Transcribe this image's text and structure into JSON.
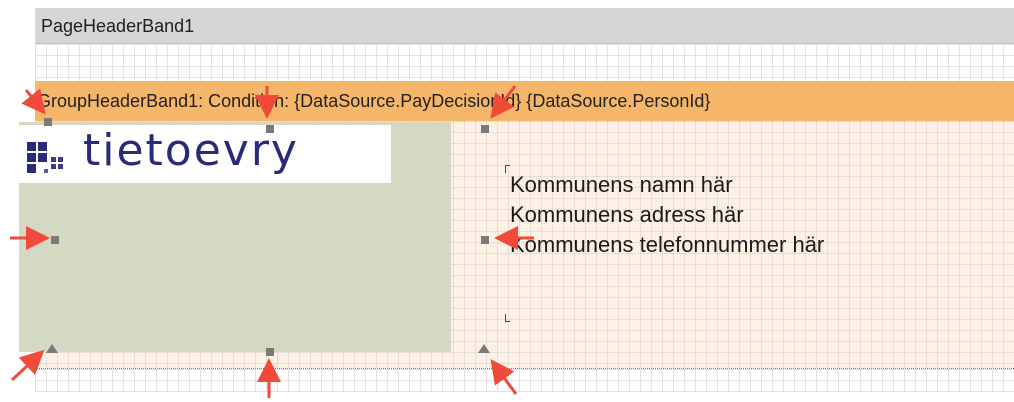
{
  "page_header": {
    "label": "PageHeaderBand1"
  },
  "group_header": {
    "label": "GroupHeaderBand1: Condition: {DataSource.PayDecisionId} {DataSource.PersonId}"
  },
  "picture": {
    "label": "Picture1",
    "logo_text": "tietoevry",
    "logo_icon": "tietoevry-logo-icon"
  },
  "textbox": {
    "lines": [
      "Kommunens namn här",
      "Kommunens adress här",
      "Kommunens telefonnummer här"
    ]
  },
  "annotation_color": "#f04a3a",
  "band_colors": {
    "page_header": "#d6d6d6",
    "group_header": "#f6b66a",
    "group_body": "#fcf1e4",
    "picture_fill": "#d5d9c3"
  }
}
